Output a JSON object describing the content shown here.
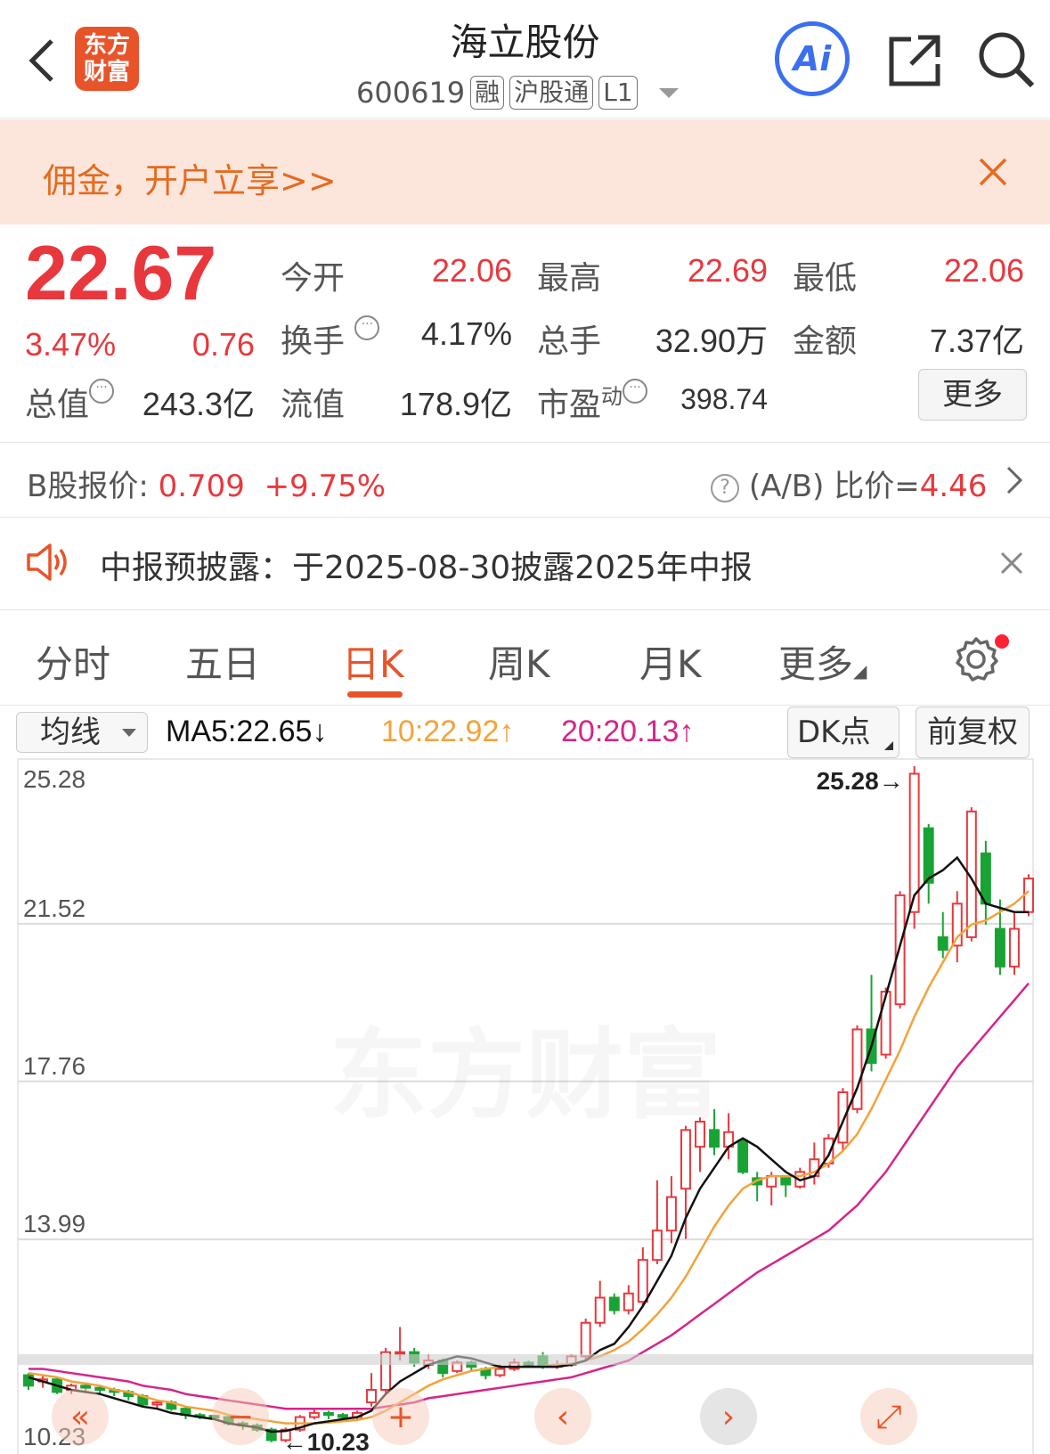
{
  "header": {
    "title": "海立股份",
    "code": "600619",
    "tags": [
      "融",
      "沪股通",
      "L1"
    ],
    "logo_text": "东方财富",
    "ai_label": "Ai"
  },
  "banner": {
    "text": "佣金，开户立享>>"
  },
  "quote": {
    "price": "22.67",
    "change_pct": "3.47%",
    "change": "0.76",
    "fields": {
      "open_label": "今开",
      "open": "22.06",
      "high_label": "最高",
      "high": "22.69",
      "low_label": "最低",
      "low": "22.06",
      "turnover_label": "换手",
      "turnover": "4.17%",
      "volume_label": "总手",
      "volume": "32.90万",
      "amount_label": "金额",
      "amount": "7.37亿",
      "mktcap_label": "总值",
      "mktcap": "243.3亿",
      "float_label": "流值",
      "float": "178.9亿",
      "pe_label": "市盈",
      "pe_sup": "动",
      "pe": "398.74"
    },
    "more_label": "更多"
  },
  "bshare": {
    "label": "B股报价:",
    "price": "0.709",
    "change": "+9.75%",
    "ratio_label": "(A/B) 比价=",
    "ratio": "4.46"
  },
  "notice": {
    "text": "中报预披露：于2025-08-30披露2025年中报"
  },
  "tabs": [
    "分时",
    "五日",
    "日K",
    "周K",
    "月K",
    "更多"
  ],
  "ma_bar": {
    "select_label": "均线",
    "ma5": "MA5:22.65↓",
    "ma10": "10:22.92↑",
    "ma20": "20:20.13↑",
    "dk_label": "DK点",
    "adjust_label": "前复权"
  },
  "colors": {
    "up": "#e8383d",
    "down": "#1aa335",
    "ma5": "#111111",
    "ma10": "#f2a33a",
    "ma20": "#d6248a",
    "accent": "#e8542a"
  },
  "chart_data": {
    "type": "candlestick",
    "y_ticks": [
      "25.28",
      "21.52",
      "17.76",
      "13.99",
      "10.23"
    ],
    "ylim": [
      10.23,
      25.28
    ],
    "max_label": "25.28→",
    "min_label": "←10.23",
    "watermark": "东方财富",
    "candles": [
      {
        "o": 10.75,
        "c": 10.5,
        "h": 10.8,
        "l": 10.4
      },
      {
        "o": 10.6,
        "c": 10.65,
        "h": 10.75,
        "l": 10.45
      },
      {
        "o": 10.65,
        "c": 10.35,
        "h": 10.7,
        "l": 10.3
      },
      {
        "o": 10.4,
        "c": 10.5,
        "h": 10.55,
        "l": 10.3
      },
      {
        "o": 10.5,
        "c": 10.45,
        "h": 10.55,
        "l": 10.35
      },
      {
        "o": 10.45,
        "c": 10.4,
        "h": 10.5,
        "l": 10.3
      },
      {
        "o": 10.4,
        "c": 10.35,
        "h": 10.45,
        "l": 10.25
      },
      {
        "o": 10.35,
        "c": 10.25,
        "h": 10.4,
        "l": 10.15
      },
      {
        "o": 10.25,
        "c": 10.05,
        "h": 10.3,
        "l": 10.0
      },
      {
        "o": 10.05,
        "c": 10.1,
        "h": 10.15,
        "l": 9.95
      },
      {
        "o": 10.1,
        "c": 9.95,
        "h": 10.15,
        "l": 9.9
      },
      {
        "o": 9.95,
        "c": 9.8,
        "h": 10.0,
        "l": 9.7
      },
      {
        "o": 9.8,
        "c": 9.78,
        "h": 9.85,
        "l": 9.7
      },
      {
        "o": 9.78,
        "c": 9.75,
        "h": 9.8,
        "l": 9.7
      },
      {
        "o": 9.75,
        "c": 9.6,
        "h": 9.8,
        "l": 9.55
      },
      {
        "o": 9.6,
        "c": 9.55,
        "h": 9.65,
        "l": 9.45
      },
      {
        "o": 9.55,
        "c": 9.45,
        "h": 9.6,
        "l": 9.4
      },
      {
        "o": 9.45,
        "c": 9.2,
        "h": 9.5,
        "l": 9.15
      },
      {
        "o": 9.2,
        "c": 9.45,
        "h": 9.5,
        "l": 9.15
      },
      {
        "o": 9.45,
        "c": 9.75,
        "h": 9.8,
        "l": 9.4
      },
      {
        "o": 9.75,
        "c": 9.85,
        "h": 9.95,
        "l": 9.7
      },
      {
        "o": 9.85,
        "c": 9.8,
        "h": 9.9,
        "l": 9.7
      },
      {
        "o": 9.8,
        "c": 9.75,
        "h": 9.85,
        "l": 9.65
      },
      {
        "o": 9.75,
        "c": 9.85,
        "h": 9.9,
        "l": 9.7
      },
      {
        "o": 10.1,
        "c": 10.4,
        "h": 10.8,
        "l": 10.0
      },
      {
        "o": 10.4,
        "c": 11.3,
        "h": 11.4,
        "l": 10.3
      },
      {
        "o": 11.3,
        "c": 11.3,
        "h": 11.9,
        "l": 11.1
      },
      {
        "o": 11.3,
        "c": 11.05,
        "h": 11.4,
        "l": 10.95
      },
      {
        "o": 11.0,
        "c": 11.1,
        "h": 11.25,
        "l": 10.9
      },
      {
        "o": 11.1,
        "c": 10.8,
        "h": 11.15,
        "l": 10.7
      },
      {
        "o": 10.85,
        "c": 11.05,
        "h": 11.1,
        "l": 10.8
      },
      {
        "o": 11.05,
        "c": 10.95,
        "h": 11.1,
        "l": 10.85
      },
      {
        "o": 10.9,
        "c": 10.75,
        "h": 10.95,
        "l": 10.65
      },
      {
        "o": 10.75,
        "c": 10.9,
        "h": 11.0,
        "l": 10.7
      },
      {
        "o": 10.9,
        "c": 11.05,
        "h": 11.15,
        "l": 10.85
      },
      {
        "o": 11.05,
        "c": 11.0,
        "h": 11.1,
        "l": 10.95
      },
      {
        "o": 11.2,
        "c": 10.95,
        "h": 11.3,
        "l": 10.9
      },
      {
        "o": 10.95,
        "c": 11.0,
        "h": 11.1,
        "l": 10.9
      },
      {
        "o": 11.0,
        "c": 11.2,
        "h": 11.25,
        "l": 10.95
      },
      {
        "o": 11.2,
        "c": 12.0,
        "h": 12.1,
        "l": 11.1
      },
      {
        "o": 12.0,
        "c": 12.6,
        "h": 13.0,
        "l": 11.9
      },
      {
        "o": 12.6,
        "c": 12.3,
        "h": 12.7,
        "l": 12.2
      },
      {
        "o": 12.3,
        "c": 12.7,
        "h": 12.9,
        "l": 12.2
      },
      {
        "o": 12.5,
        "c": 13.5,
        "h": 13.8,
        "l": 12.4
      },
      {
        "o": 13.5,
        "c": 14.2,
        "h": 15.4,
        "l": 13.4
      },
      {
        "o": 14.2,
        "c": 15.0,
        "h": 15.5,
        "l": 13.9
      },
      {
        "o": 15.2,
        "c": 16.6,
        "h": 16.7,
        "l": 14.0
      },
      {
        "o": 16.2,
        "c": 16.8,
        "h": 16.9,
        "l": 15.6
      },
      {
        "o": 16.6,
        "c": 16.2,
        "h": 17.1,
        "l": 16.0
      },
      {
        "o": 16.2,
        "c": 16.55,
        "h": 17.0,
        "l": 15.9
      },
      {
        "o": 16.35,
        "c": 15.6,
        "h": 16.4,
        "l": 15.55
      },
      {
        "o": 15.45,
        "c": 15.3,
        "h": 15.6,
        "l": 14.9
      },
      {
        "o": 15.25,
        "c": 15.5,
        "h": 15.6,
        "l": 14.8
      },
      {
        "o": 15.45,
        "c": 15.3,
        "h": 15.5,
        "l": 15.0
      },
      {
        "o": 15.25,
        "c": 15.6,
        "h": 15.7,
        "l": 15.2
      },
      {
        "o": 15.5,
        "c": 15.9,
        "h": 16.3,
        "l": 15.3
      },
      {
        "o": 15.8,
        "c": 16.4,
        "h": 16.5,
        "l": 15.7
      },
      {
        "o": 16.3,
        "c": 17.5,
        "h": 17.6,
        "l": 16.1
      },
      {
        "o": 17.1,
        "c": 19.0,
        "h": 19.1,
        "l": 17.0
      },
      {
        "o": 19.0,
        "c": 18.2,
        "h": 20.3,
        "l": 18.0
      },
      {
        "o": 18.4,
        "c": 19.9,
        "h": 20.0,
        "l": 18.3
      },
      {
        "o": 19.6,
        "c": 22.2,
        "h": 22.3,
        "l": 19.5
      },
      {
        "o": 21.8,
        "c": 25.1,
        "h": 25.28,
        "l": 21.4
      },
      {
        "o": 23.8,
        "c": 22.5,
        "h": 23.9,
        "l": 22.0
      },
      {
        "o": 21.2,
        "c": 20.9,
        "h": 21.8,
        "l": 20.7
      },
      {
        "o": 21.0,
        "c": 22.0,
        "h": 22.3,
        "l": 20.6
      },
      {
        "o": 21.2,
        "c": 24.2,
        "h": 24.3,
        "l": 21.1
      },
      {
        "o": 23.2,
        "c": 22.0,
        "h": 23.5,
        "l": 21.5
      },
      {
        "o": 21.4,
        "c": 20.5,
        "h": 22.1,
        "l": 20.3
      },
      {
        "o": 20.5,
        "c": 21.4,
        "h": 21.8,
        "l": 20.3
      },
      {
        "o": 21.8,
        "c": 22.6,
        "h": 22.7,
        "l": 21.7
      }
    ],
    "ma5": [
      10.7,
      10.6,
      10.5,
      10.4,
      10.35,
      10.3,
      10.2,
      10.1,
      10.0,
      9.95,
      9.85,
      9.8,
      9.75,
      9.7,
      9.6,
      9.55,
      9.5,
      9.4,
      9.42,
      9.5,
      9.6,
      9.65,
      9.7,
      9.75,
      9.9,
      10.3,
      10.6,
      10.8,
      11.0,
      11.1,
      11.2,
      11.15,
      11.05,
      10.95,
      10.95,
      10.95,
      10.95,
      10.95,
      11.0,
      11.1,
      11.35,
      11.5,
      11.9,
      12.4,
      13.0,
      13.6,
      14.5,
      15.2,
      15.7,
      16.2,
      16.4,
      16.2,
      15.9,
      15.6,
      15.4,
      15.5,
      16.0,
      16.8,
      17.6,
      18.6,
      19.8,
      21.0,
      22.2,
      22.6,
      22.8,
      23.1,
      22.6,
      22.0,
      21.9,
      21.8,
      21.8
    ],
    "ma10": [
      10.8,
      10.75,
      10.7,
      10.6,
      10.55,
      10.5,
      10.4,
      10.35,
      10.25,
      10.15,
      10.1,
      10.0,
      9.95,
      9.9,
      9.8,
      9.75,
      9.7,
      9.65,
      9.6,
      9.6,
      9.6,
      9.62,
      9.65,
      9.68,
      9.75,
      9.9,
      10.1,
      10.3,
      10.5,
      10.65,
      10.75,
      10.85,
      10.9,
      10.95,
      10.95,
      10.95,
      10.97,
      11.0,
      11.02,
      11.1,
      11.2,
      11.35,
      11.55,
      11.85,
      12.2,
      12.6,
      13.1,
      13.7,
      14.3,
      14.8,
      15.2,
      15.4,
      15.5,
      15.5,
      15.5,
      15.6,
      15.8,
      16.1,
      16.5,
      17.1,
      17.8,
      18.5,
      19.3,
      20.0,
      20.6,
      21.2,
      21.5,
      21.6,
      21.8,
      22.0,
      22.3
    ],
    "ma20": [
      10.9,
      10.9,
      10.85,
      10.8,
      10.75,
      10.7,
      10.65,
      10.6,
      10.5,
      10.45,
      10.4,
      10.3,
      10.25,
      10.2,
      10.15,
      10.1,
      10.05,
      10.0,
      9.95,
      9.95,
      9.95,
      9.95,
      9.95,
      9.95,
      9.95,
      10.0,
      10.05,
      10.1,
      10.2,
      10.25,
      10.3,
      10.35,
      10.4,
      10.45,
      10.5,
      10.55,
      10.6,
      10.65,
      10.7,
      10.8,
      10.9,
      11.0,
      11.1,
      11.3,
      11.5,
      11.7,
      11.95,
      12.2,
      12.45,
      12.7,
      12.95,
      13.2,
      13.4,
      13.6,
      13.8,
      14.0,
      14.2,
      14.5,
      14.8,
      15.2,
      15.6,
      16.1,
      16.6,
      17.1,
      17.6,
      18.1,
      18.5,
      18.9,
      19.3,
      19.7,
      20.1
    ]
  }
}
